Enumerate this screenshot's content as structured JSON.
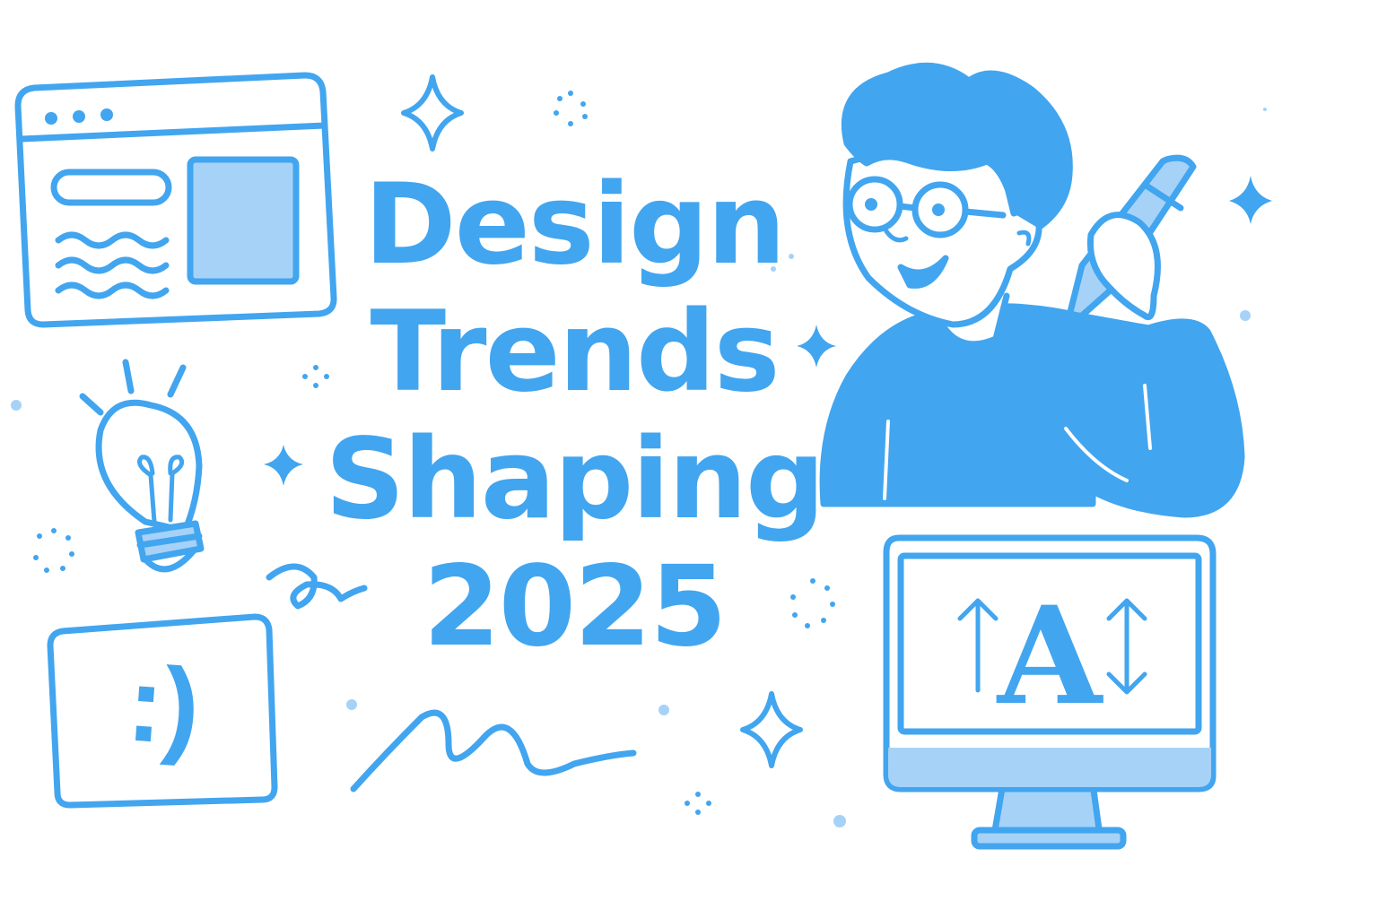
{
  "headline": {
    "line1": "Design",
    "line2": "Trends",
    "line3": "Shaping",
    "line4": "2025"
  },
  "monitor": {
    "glyph": "A"
  },
  "emoticon": {
    "text": ":)"
  },
  "icons": [
    "browser-window-icon",
    "lightbulb-icon",
    "emoticon-card-icon",
    "designer-character",
    "pencil-icon",
    "monitor-icon",
    "font-size-up-arrow-icon",
    "font-size-down-arrow-icon",
    "sparkle-icon",
    "squiggle-decoration"
  ],
  "colors": {
    "primary": "#42a5ef",
    "light": "#a6d2f8",
    "background": "#ffffff"
  }
}
